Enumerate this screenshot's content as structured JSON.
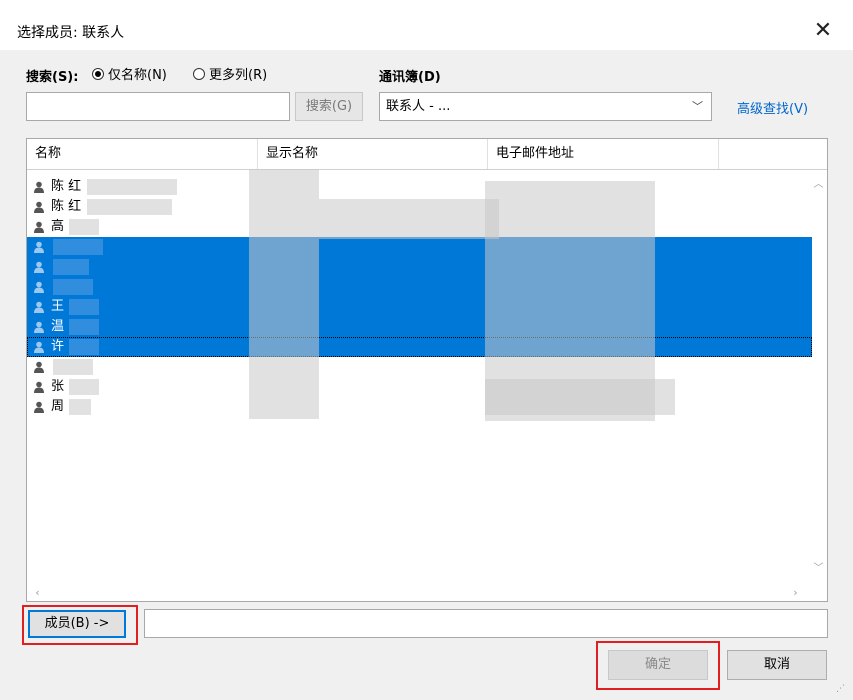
{
  "window": {
    "title": "选择成员: 联系人",
    "close_glyph": "✕"
  },
  "search": {
    "label": "搜索(S):",
    "option_name_only": "仅名称(N)",
    "option_more_columns": "更多列(R)",
    "selected_option": "仅名称(N)",
    "input_value": "",
    "button_label": "搜索(G)"
  },
  "addressbook": {
    "label": "通讯簿(D)",
    "selected": "联系人 - ...",
    "advanced_link": "高级查找(V)"
  },
  "list": {
    "columns": [
      "名称",
      "显示名称",
      "电子邮件地址"
    ],
    "rows": [
      {
        "name": "陈 红",
        "selected": false
      },
      {
        "name": "陈 红",
        "selected": false
      },
      {
        "name": "高",
        "selected": false
      },
      {
        "name": "",
        "selected": true
      },
      {
        "name": "",
        "selected": true
      },
      {
        "name": "",
        "selected": true
      },
      {
        "name": "王",
        "selected": true
      },
      {
        "name": "温",
        "selected": true
      },
      {
        "name": "许",
        "selected": true
      },
      {
        "name": "",
        "selected": false
      },
      {
        "name": "张",
        "selected": false
      },
      {
        "name": "周",
        "selected": false
      }
    ]
  },
  "members": {
    "button_label": "成员(B) ->",
    "input_value": ""
  },
  "footer": {
    "ok_label": "确定",
    "cancel_label": "取消"
  }
}
